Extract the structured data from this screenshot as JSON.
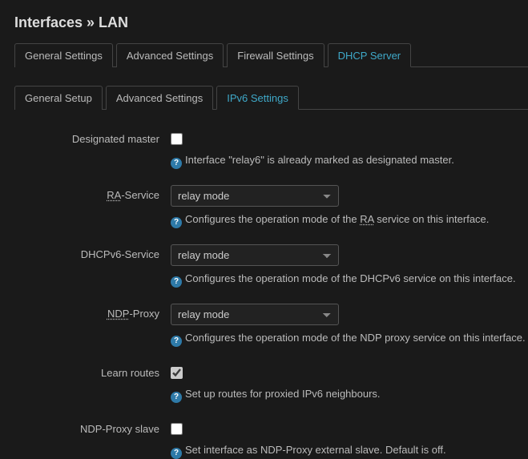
{
  "page_title": "Interfaces » LAN",
  "tabs_primary": [
    {
      "label": "General Settings",
      "active": false
    },
    {
      "label": "Advanced Settings",
      "active": false
    },
    {
      "label": "Firewall Settings",
      "active": false
    },
    {
      "label": "DHCP Server",
      "active": true
    }
  ],
  "tabs_secondary": [
    {
      "label": "General Setup",
      "active": false
    },
    {
      "label": "Advanced Settings",
      "active": false
    },
    {
      "label": "IPv6 Settings",
      "active": true
    }
  ],
  "fields": {
    "designated_master": {
      "label": "Designated master",
      "checked": false,
      "hint": "Interface \"relay6\" is already marked as designated master."
    },
    "ra_service": {
      "label_pre": "",
      "label_abbr": "RA",
      "label_post": "-Service",
      "value": "relay mode",
      "options": [
        "relay mode"
      ],
      "hint_pre": "Configures the operation mode of the ",
      "hint_abbr": "RA",
      "hint_post": " service on this interface."
    },
    "dhcpv6_service": {
      "label": "DHCPv6-Service",
      "value": "relay mode",
      "options": [
        "relay mode"
      ],
      "hint": "Configures the operation mode of the DHCPv6 service on this interface."
    },
    "ndp_proxy": {
      "label_abbr": "NDP",
      "label_post": "-Proxy",
      "value": "relay mode",
      "options": [
        "relay mode"
      ],
      "hint": "Configures the operation mode of the NDP proxy service on this interface."
    },
    "learn_routes": {
      "label": "Learn routes",
      "checked": true,
      "hint": "Set up routes for proxied IPv6 neighbours."
    },
    "ndp_proxy_slave": {
      "label": "NDP-Proxy slave",
      "checked": false,
      "hint": "Set interface as NDP-Proxy external slave. Default is off."
    }
  }
}
